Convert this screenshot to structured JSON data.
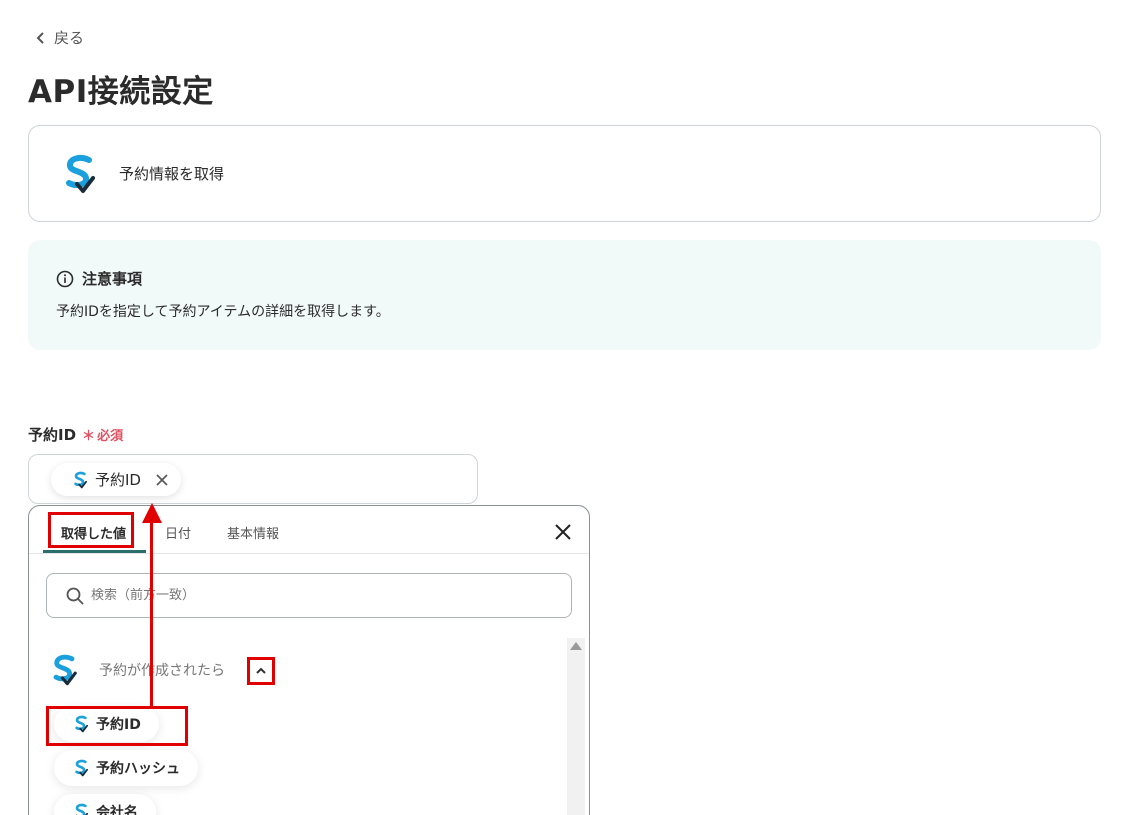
{
  "header": {
    "back_label": "戻る",
    "title": "API接続設定"
  },
  "action": {
    "icon": "app-s-logo-icon",
    "name": "予約情報を取得"
  },
  "notice": {
    "icon": "info-icon",
    "title": "注意事項",
    "body": "予約IDを指定して予約アイテムの詳細を取得します。"
  },
  "field": {
    "label": "予約ID",
    "required_mark": "＊",
    "required_label": "必須",
    "chip_label": "予約ID"
  },
  "panel": {
    "tabs": [
      {
        "label": "取得した値",
        "active": true
      },
      {
        "label": "日付",
        "active": false
      },
      {
        "label": "基本情報",
        "active": false
      }
    ],
    "search_placeholder": "検索（前方一致）",
    "group_label": "予約が作成されたら",
    "items": [
      {
        "label": "予約ID"
      },
      {
        "label": "予約ハッシュ"
      },
      {
        "label": "会社名"
      }
    ]
  },
  "colors": {
    "brand": "#1aa0dc",
    "highlight": "#e00000",
    "required": "#e05263",
    "tab_underline": "#2b6e6a",
    "notice_bg": "#f2faf9"
  }
}
